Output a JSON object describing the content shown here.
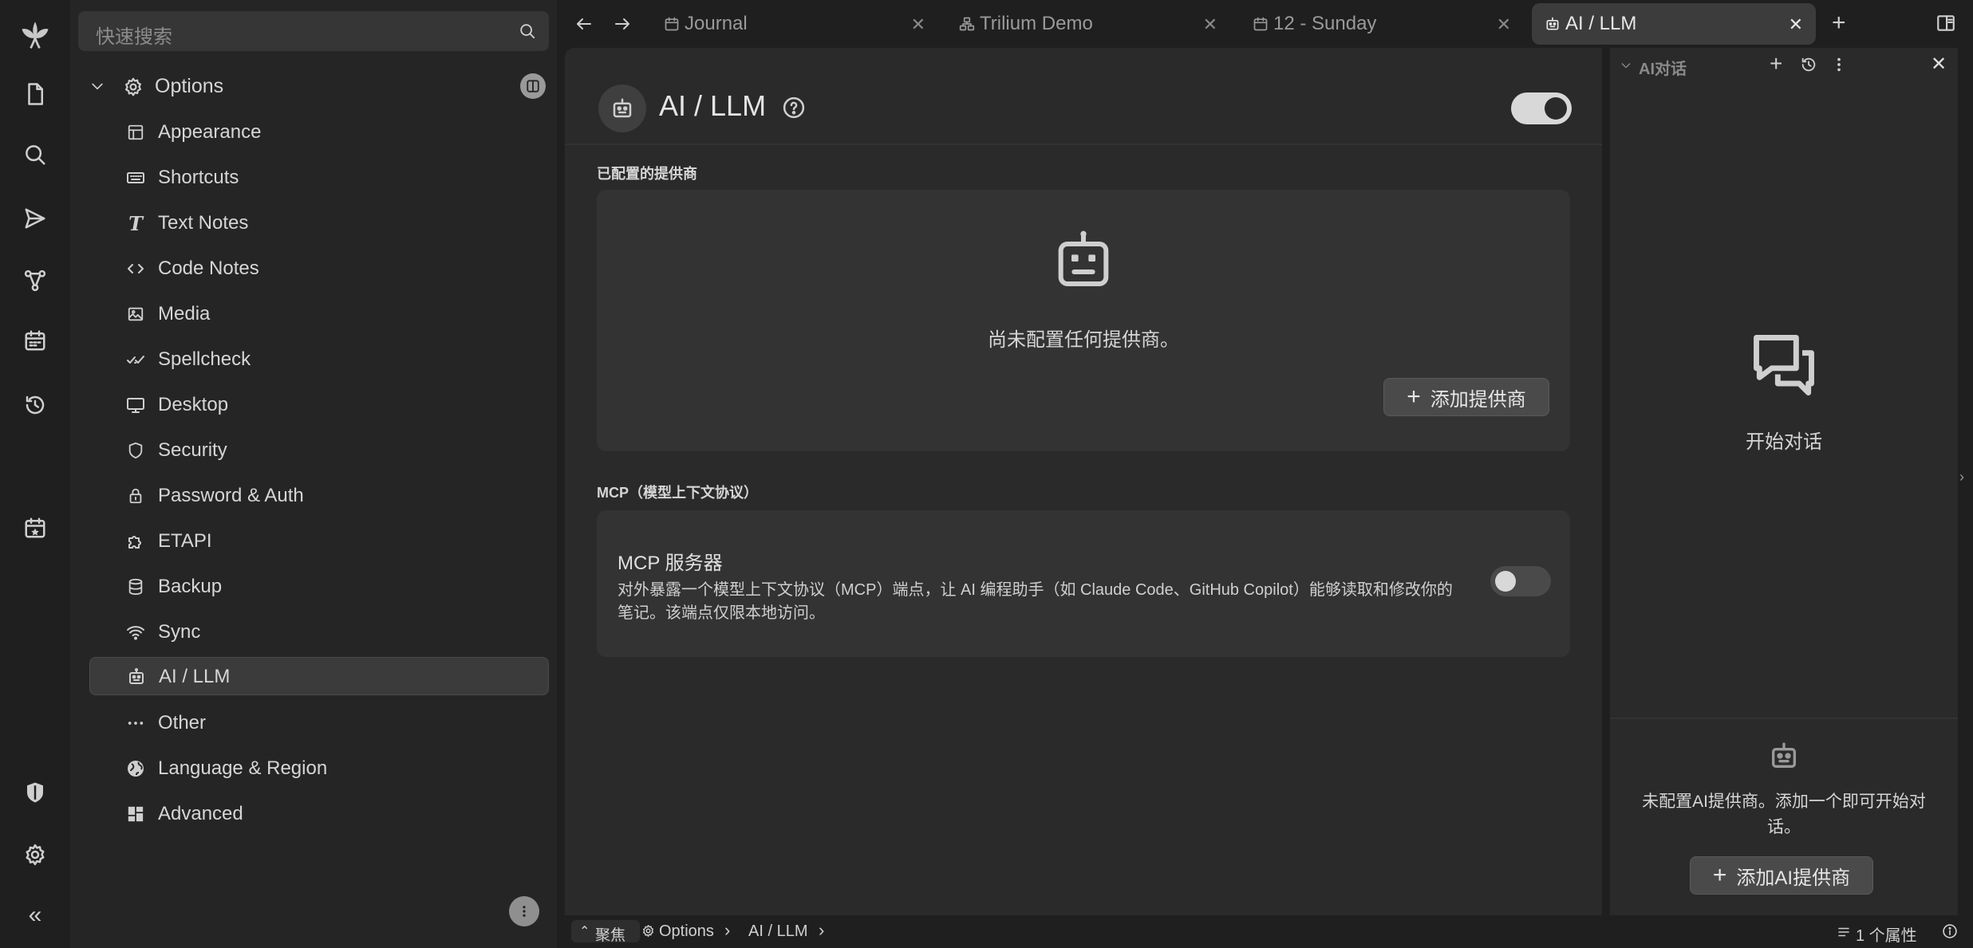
{
  "tree": {
    "search_placeholder": "快速搜索",
    "root_label": "Options",
    "items": [
      {
        "label": "Appearance",
        "icon": "layout-icon"
      },
      {
        "label": "Shortcuts",
        "icon": "keyboard-icon"
      },
      {
        "label": "Text Notes",
        "icon": "text-icon"
      },
      {
        "label": "Code Notes",
        "icon": "code-icon"
      },
      {
        "label": "Media",
        "icon": "image-icon"
      },
      {
        "label": "Spellcheck",
        "icon": "spellcheck-icon"
      },
      {
        "label": "Desktop",
        "icon": "monitor-icon"
      },
      {
        "label": "Security",
        "icon": "shield-icon"
      },
      {
        "label": "Password & Auth",
        "icon": "lock-icon"
      },
      {
        "label": "ETAPI",
        "icon": "puzzle-icon"
      },
      {
        "label": "Backup",
        "icon": "database-icon"
      },
      {
        "label": "Sync",
        "icon": "wifi-icon"
      },
      {
        "label": "AI / LLM",
        "icon": "robot-icon",
        "active": true
      },
      {
        "label": "Other",
        "icon": "dots-icon"
      },
      {
        "label": "Language & Region",
        "icon": "globe-icon"
      },
      {
        "label": "Advanced",
        "icon": "grid-icon"
      }
    ]
  },
  "tabs": [
    {
      "label": "Journal",
      "icon": "calendar-icon"
    },
    {
      "label": "Trilium Demo",
      "icon": "hierarchy-icon"
    },
    {
      "label": "12 - Sunday",
      "icon": "calendar-icon"
    },
    {
      "label": "AI / LLM",
      "icon": "robot-icon",
      "active": true
    }
  ],
  "note": {
    "title": "AI / LLM",
    "enabled": true,
    "providers_section": "已配置的提供商",
    "no_providers": "尚未配置任何提供商。",
    "add_provider": "添加提供商",
    "mcp_section": "MCP（模型上下文协议）",
    "mcp_title": "MCP 服务器",
    "mcp_desc": "对外暴露一个模型上下文协议（MCP）端点，让 AI 编程助手（如 Claude Code、GitHub Copilot）能够读取和修改你的笔记。该端点仅限本地访问。",
    "mcp_enabled": false
  },
  "right_pane": {
    "title": "AI对话",
    "start_chat": "开始对话",
    "no_provider_msg": "未配置AI提供商。添加一个即可开始对话。",
    "add_ai_provider": "添加AI提供商"
  },
  "status": {
    "focus": "聚焦",
    "crumb1": "Options",
    "crumb2": "AI / LLM",
    "attributes": "1 个属性"
  },
  "colors": {
    "bg": "#1f1f1f",
    "panel": "#252525",
    "note": "#2a2a2a",
    "card": "#333333",
    "active_item": "#3b3b3b"
  }
}
